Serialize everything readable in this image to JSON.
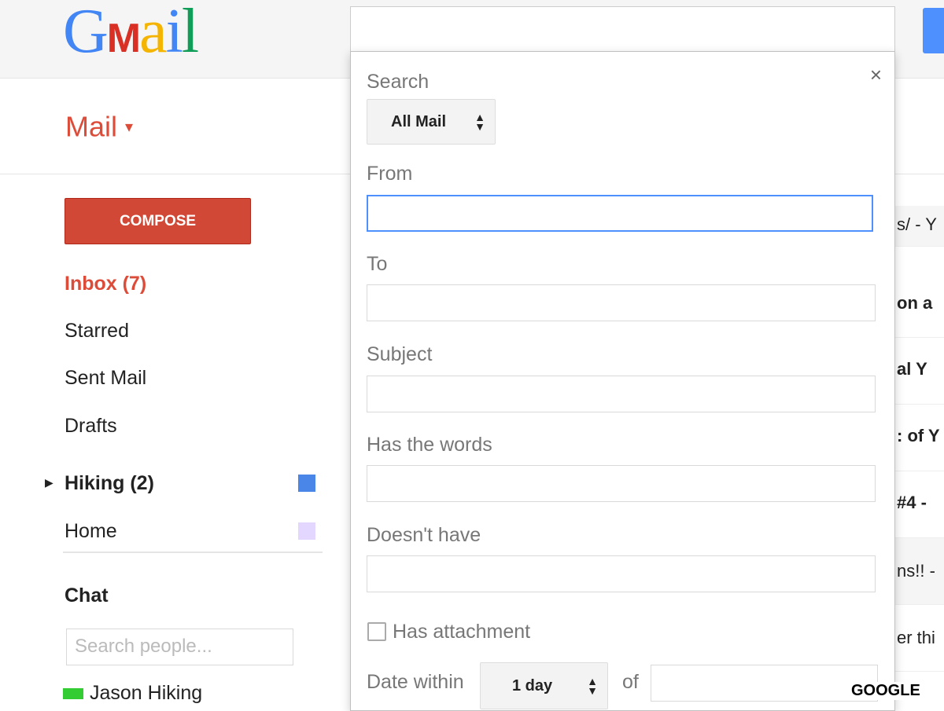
{
  "header": {
    "logo": "Gmail",
    "search_value": ""
  },
  "app_switcher": "Mail",
  "compose": "COMPOSE",
  "nav": [
    {
      "label": "Inbox (7)",
      "active": true
    },
    {
      "label": "Starred"
    },
    {
      "label": "Sent Mail"
    },
    {
      "label": "Drafts"
    },
    {
      "label": "Hiking (2)",
      "color": "#4a86e8",
      "bold": true
    },
    {
      "label": "Home",
      "color": "#e3d7ff"
    }
  ],
  "chat": {
    "label": "Chat",
    "search_placeholder": "Search people...",
    "contacts": [
      "Jason Hiking"
    ]
  },
  "email_rows": [
    "s/ - Y",
    "on a",
    "al Y",
    ": of Y",
    "#4 -",
    "ns!! -",
    "er thi"
  ],
  "search_panel": {
    "search_label": "Search",
    "scope": "All Mail",
    "from_label": "From",
    "to_label": "To",
    "subject_label": "Subject",
    "has_words_label": "Has the words",
    "doesnt_have_label": "Doesn't have",
    "has_attachment_label": "Has attachment",
    "has_attachment": false,
    "date_within_label": "Date within",
    "date_within": "1 day",
    "of_label": "of",
    "close": "×"
  },
  "watermark": "GOOGLE"
}
